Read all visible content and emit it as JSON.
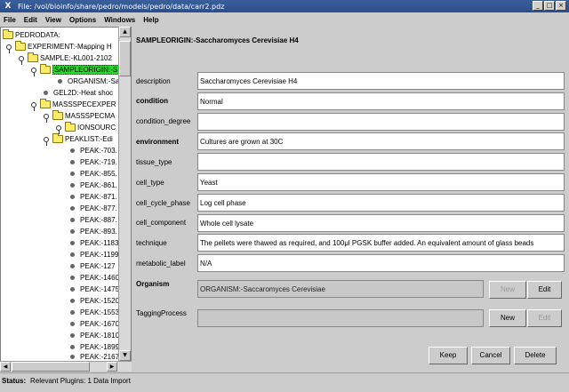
{
  "window": {
    "title": "File: /vol/bioinfo/share/pedro/models/pedro/data/carr2.pdz",
    "app_icon": "X",
    "buttons": [
      "_",
      "□",
      "×"
    ]
  },
  "menu": [
    "File",
    "Edit",
    "View",
    "Options",
    "Windows",
    "Help"
  ],
  "tree": {
    "nodes": [
      {
        "label": "PEDRODATA:",
        "icon": "folder"
      },
      {
        "label": "EXPERIMENT:-Mapping H",
        "icon": "folder"
      },
      {
        "label": "SAMPLE:-KL001-2102",
        "icon": "folder"
      },
      {
        "label": "SAMPLEORIGIN:-S",
        "icon": "folder",
        "selected": true
      },
      {
        "label": "ORGANISM:-Sa",
        "icon": "leaf"
      },
      {
        "label": "GEL2D:-Heat shoc",
        "icon": "leaf"
      },
      {
        "label": "MASSSPECEXPER",
        "icon": "folder"
      },
      {
        "label": "MASSSPECMA",
        "icon": "folder"
      },
      {
        "label": "IONSOURC",
        "icon": "folder"
      },
      {
        "label": "PEAKLIST:-Edi",
        "icon": "folder"
      },
      {
        "label": "PEAK:-703.",
        "icon": "leaf"
      },
      {
        "label": "PEAK:-719.",
        "icon": "leaf"
      },
      {
        "label": "PEAK:-855.",
        "icon": "leaf"
      },
      {
        "label": "PEAK:-861.",
        "icon": "leaf"
      },
      {
        "label": "PEAK:-871.",
        "icon": "leaf"
      },
      {
        "label": "PEAK:-877.",
        "icon": "leaf"
      },
      {
        "label": "PEAK:-887.",
        "icon": "leaf"
      },
      {
        "label": "PEAK:-893.",
        "icon": "leaf"
      },
      {
        "label": "PEAK:-1183",
        "icon": "leaf"
      },
      {
        "label": "PEAK:-1199",
        "icon": "leaf"
      },
      {
        "label": "PEAK:-127",
        "icon": "leaf"
      },
      {
        "label": "PEAK:-1460",
        "icon": "leaf"
      },
      {
        "label": "PEAK:-1475",
        "icon": "leaf"
      },
      {
        "label": "PEAK:-1520",
        "icon": "leaf"
      },
      {
        "label": "PEAK:-1553",
        "icon": "leaf"
      },
      {
        "label": "PEAK:-1670",
        "icon": "leaf"
      },
      {
        "label": "PEAK:-1810",
        "icon": "leaf"
      },
      {
        "label": "PEAK:-1899",
        "icon": "leaf"
      },
      {
        "label": "PEAK:-2167",
        "icon": "leaf"
      }
    ]
  },
  "scrollbars": {
    "up": "▲",
    "down": "▼",
    "left": "◀",
    "right": "▶"
  },
  "form": {
    "title": "SAMPLEORIGIN:-Saccharomyces Cerevisiae H4",
    "fields": [
      {
        "label": "description",
        "value": "Saccharomyces Cerevisiae H4",
        "bold": false
      },
      {
        "label": "condition",
        "value": "Normal",
        "bold": true
      },
      {
        "label": "condition_degree",
        "value": "",
        "bold": false
      },
      {
        "label": "environment",
        "value": "Cultures are grown at 30C",
        "bold": true
      },
      {
        "label": "tissue_type",
        "value": "",
        "bold": false
      },
      {
        "label": "cell_type",
        "value": "Yeast",
        "bold": false
      },
      {
        "label": "cell_cycle_phase",
        "value": "Log cell phase",
        "bold": false
      },
      {
        "label": "cell_component",
        "value": "Whole cell lysate",
        "bold": false
      },
      {
        "label": "technique",
        "value": "The pellets were thawed as required, and 100μl PGSK buffer added. An equivalent amount of glass beads",
        "bold": false
      },
      {
        "label": "metabolic_label",
        "value": "N/A",
        "bold": false
      }
    ],
    "organism": {
      "label": "Organism",
      "value": "ORGANISM:-Saccaromyces Cerevisiae",
      "new": "New",
      "edit": "Edit"
    },
    "tagging": {
      "label": "TaggingProcess",
      "value": "",
      "new": "New",
      "edit": "Edit"
    },
    "buttons": {
      "keep": "Keep",
      "cancel": "Cancel",
      "delete": "Delete"
    }
  },
  "status": {
    "label": "Status:",
    "text": "Relevant Plugins:  1 Data Import"
  }
}
